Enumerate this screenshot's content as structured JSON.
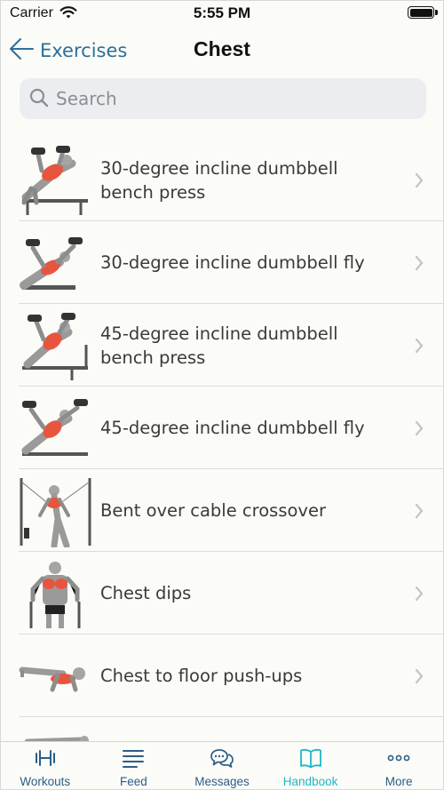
{
  "status_bar": {
    "carrier": "Carrier",
    "time": "5:55 PM",
    "icons": [
      "wifi-icon",
      "battery-icon"
    ]
  },
  "nav": {
    "back_label": "Exercises",
    "title": "Chest"
  },
  "search": {
    "placeholder": "Search",
    "value": ""
  },
  "exercises": [
    {
      "name": "30-degree incline dumbbell bench press",
      "thumb": "incline-bench-press"
    },
    {
      "name": "30-degree incline dumbbell fly",
      "thumb": "incline-fly"
    },
    {
      "name": "45-degree incline dumbbell bench press",
      "thumb": "incline-bench-press"
    },
    {
      "name": "45-degree incline dumbbell fly",
      "thumb": "incline-fly"
    },
    {
      "name": "Bent over cable crossover",
      "thumb": "cable-crossover"
    },
    {
      "name": "Chest dips",
      "thumb": "dips"
    },
    {
      "name": "Chest to floor push-ups",
      "thumb": "pushups"
    }
  ],
  "tabs": [
    {
      "label": "Workouts",
      "icon": "dumbbell-icon",
      "active": false
    },
    {
      "label": "Feed",
      "icon": "feed-icon",
      "active": false
    },
    {
      "label": "Messages",
      "icon": "messages-icon",
      "active": false
    },
    {
      "label": "Handbook",
      "icon": "book-icon",
      "active": true
    },
    {
      "label": "More",
      "icon": "more-icon",
      "active": false
    }
  ],
  "colors": {
    "accent": "#1fb7c8",
    "tab_inactive": "#2c5e87",
    "back": "#2d6f99",
    "muscle_highlight": "#e8553e"
  }
}
